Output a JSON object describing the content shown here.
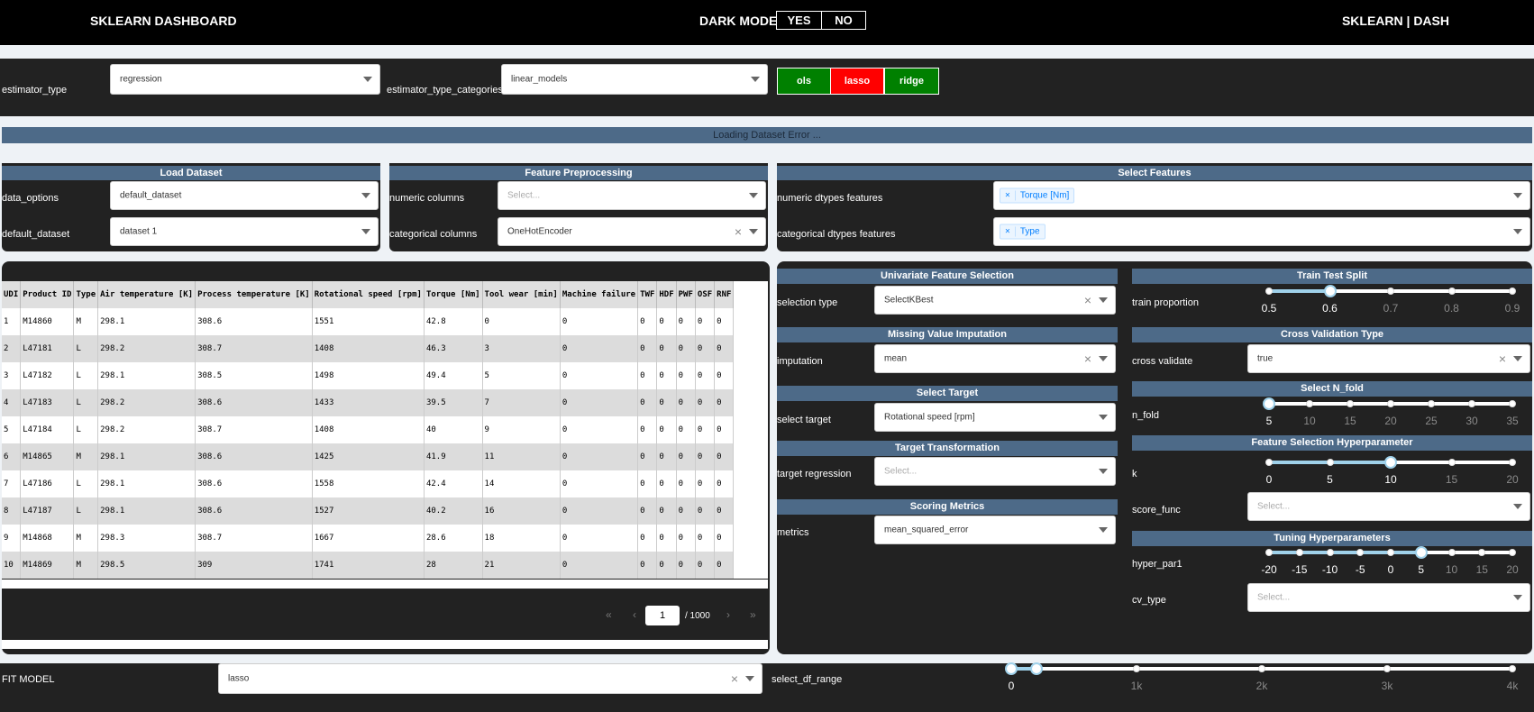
{
  "header": {
    "title": "SKLEARN DASHBOARD",
    "dark_mode_label": "DARK MODE",
    "yes": "YES",
    "no": "NO",
    "right": "SKLEARN | DASH"
  },
  "estimator": {
    "type_label": "estimator_type",
    "type_value": "regression",
    "cat_label": "estimator_type_categories",
    "cat_value": "linear_models",
    "models": [
      {
        "label": "ols",
        "color": "#008000"
      },
      {
        "label": "lasso",
        "color": "#ff0000"
      },
      {
        "label": "ridge",
        "color": "#008000"
      }
    ]
  },
  "error_text": "Loading Dataset Error ...",
  "load": {
    "title": "Load Dataset",
    "data_options_label": "data_options",
    "data_options_value": "default_dataset",
    "default_dataset_label": "default_dataset",
    "default_dataset_value": "dataset 1"
  },
  "preproc": {
    "title": "Feature Preprocessing",
    "numeric_label": "numeric columns",
    "numeric_placeholder": "Select...",
    "categorical_label": "categorical columns",
    "categorical_value": "OneHotEncoder"
  },
  "features": {
    "title": "Select Features",
    "numeric_label": "numeric dtypes features",
    "numeric_tag": "Torque [Nm]",
    "categorical_label": "categorical dtypes features",
    "categorical_tag": "Type"
  },
  "table": {
    "columns": [
      "UDI",
      "Product ID",
      "Type",
      "Air temperature [K]",
      "Process temperature [K]",
      "Rotational speed [rpm]",
      "Torque [Nm]",
      "Tool wear [min]",
      "Machine failure",
      "TWF",
      "HDF",
      "PWF",
      "OSF",
      "RNF"
    ],
    "rows": [
      [
        "1",
        "M14860",
        "M",
        "298.1",
        "308.6",
        "1551",
        "42.8",
        "0",
        "0",
        "0",
        "0",
        "0",
        "0",
        "0"
      ],
      [
        "2",
        "L47181",
        "L",
        "298.2",
        "308.7",
        "1408",
        "46.3",
        "3",
        "0",
        "0",
        "0",
        "0",
        "0",
        "0"
      ],
      [
        "3",
        "L47182",
        "L",
        "298.1",
        "308.5",
        "1498",
        "49.4",
        "5",
        "0",
        "0",
        "0",
        "0",
        "0",
        "0"
      ],
      [
        "4",
        "L47183",
        "L",
        "298.2",
        "308.6",
        "1433",
        "39.5",
        "7",
        "0",
        "0",
        "0",
        "0",
        "0",
        "0"
      ],
      [
        "5",
        "L47184",
        "L",
        "298.2",
        "308.7",
        "1408",
        "40",
        "9",
        "0",
        "0",
        "0",
        "0",
        "0",
        "0"
      ],
      [
        "6",
        "M14865",
        "M",
        "298.1",
        "308.6",
        "1425",
        "41.9",
        "11",
        "0",
        "0",
        "0",
        "0",
        "0",
        "0"
      ],
      [
        "7",
        "L47186",
        "L",
        "298.1",
        "308.6",
        "1558",
        "42.4",
        "14",
        "0",
        "0",
        "0",
        "0",
        "0",
        "0"
      ],
      [
        "8",
        "L47187",
        "L",
        "298.1",
        "308.6",
        "1527",
        "40.2",
        "16",
        "0",
        "0",
        "0",
        "0",
        "0",
        "0"
      ],
      [
        "9",
        "M14868",
        "M",
        "298.3",
        "308.7",
        "1667",
        "28.6",
        "18",
        "0",
        "0",
        "0",
        "0",
        "0",
        "0"
      ],
      [
        "10",
        "M14869",
        "M",
        "298.5",
        "309",
        "1741",
        "28",
        "21",
        "0",
        "0",
        "0",
        "0",
        "0",
        "0"
      ]
    ],
    "page": "1",
    "page_total": "/ 1000"
  },
  "ufs": {
    "title": "Univariate Feature Selection",
    "label": "selection type",
    "value": "SelectKBest"
  },
  "imp": {
    "title": "Missing Value Imputation",
    "label": "imputation",
    "value": "mean"
  },
  "target": {
    "title": "Select Target",
    "label": "select target",
    "value": "Rotational speed [rpm]"
  },
  "ttrans": {
    "title": "Target Transformation",
    "label": "target regression",
    "placeholder": "Select..."
  },
  "scoring": {
    "title": "Scoring Metrics",
    "label": "metrics",
    "value": "mean_squared_error"
  },
  "tts": {
    "title": "Train Test Split",
    "label": "train proportion",
    "ticks": [
      "0.5",
      "0.6",
      "0.7",
      "0.8",
      "0.9"
    ],
    "value": 0.6
  },
  "cvt": {
    "title": "Cross Validation Type",
    "label": "cross validate",
    "value": "true"
  },
  "nfold": {
    "title": "Select N_fold",
    "label": "n_fold",
    "ticks": [
      "5",
      "10",
      "15",
      "20",
      "25",
      "30",
      "35"
    ],
    "value": 5
  },
  "fsh": {
    "title": "Feature Selection Hyperparameter",
    "k_label": "k",
    "ticks": [
      "0",
      "5",
      "10",
      "15",
      "20"
    ],
    "value": 10,
    "score_label": "score_func",
    "score_placeholder": "Select..."
  },
  "tuning": {
    "title": "Tuning Hyperparameters",
    "label": "hyper_par1",
    "ticks": [
      "-20",
      "-15",
      "-10",
      "-5",
      "0",
      "5",
      "10",
      "15",
      "20"
    ],
    "value": 5,
    "cv_label": "cv_type",
    "cv_placeholder": "Select..."
  },
  "fit": {
    "label": "FIT MODEL",
    "value": "lasso",
    "range_label": "select_df_range",
    "ticks": [
      "0",
      "1k",
      "2k",
      "3k",
      "4k"
    ],
    "range": [
      0,
      200
    ]
  }
}
